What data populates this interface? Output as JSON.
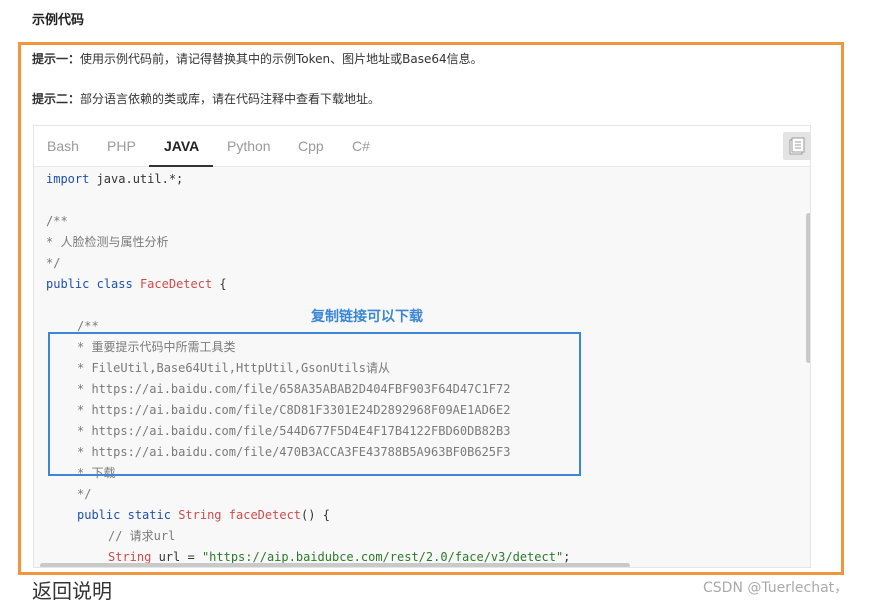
{
  "section_title": "示例代码",
  "tips": [
    {
      "label": "提示一：",
      "text": "使用示例代码前，请记得替换其中的示例Token、图片地址或Base64信息。"
    },
    {
      "label": "提示二：",
      "text": "部分语言依赖的类或库，请在代码注释中查看下载地址。"
    }
  ],
  "tabs": [
    "Bash",
    "PHP",
    "JAVA",
    "Python",
    "Cpp",
    "C#"
  ],
  "active_tab": "JAVA",
  "copy_icon": "copy-icon",
  "code": {
    "l1_kw": "import",
    "l1_rest": " java.util.*;",
    "l3": "/**",
    "l4": "* 人脸检测与属性分析",
    "l5": "*/",
    "l6_kw1": "public",
    "l6_kw2": "class",
    "l6_cls": "FaceDetect",
    "l6_rest": " {",
    "l8": "/**",
    "l9": "* 重要提示代码中所需工具类",
    "l10": "* FileUtil,Base64Util,HttpUtil,GsonUtils请从",
    "l11": "* https://ai.baidu.com/file/658A35ABAB2D404FBF903F64D47C1F72",
    "l12": "* https://ai.baidu.com/file/C8D81F3301E24D2892968F09AE1AD6E2",
    "l13": "* https://ai.baidu.com/file/544D677F5D4E4F17B4122FBD60DB82B3",
    "l14": "* https://ai.baidu.com/file/470B3ACCA3FE43788B5A963BF0B625F3",
    "l15": "* 下载",
    "l16": "*/",
    "l17_kw1": "public",
    "l17_kw2": "static",
    "l17_cls": "String",
    "l17_fn": "faceDetect",
    "l17_rest": "() {",
    "l18": "// 请求url",
    "l19_cls": "String",
    "l19_mid": " url = ",
    "l19_str": "\"https://aip.baidubce.com/rest/2.0/face/v3/detect\"",
    "l19_end": ";"
  },
  "annotation_label": "复制链接可以下载",
  "footer_title": "返回说明",
  "watermark": "CSDN @Tuerlechat，",
  "colors": {
    "orange_frame": "#f0963e",
    "blue_annotation": "#3b86d6"
  }
}
